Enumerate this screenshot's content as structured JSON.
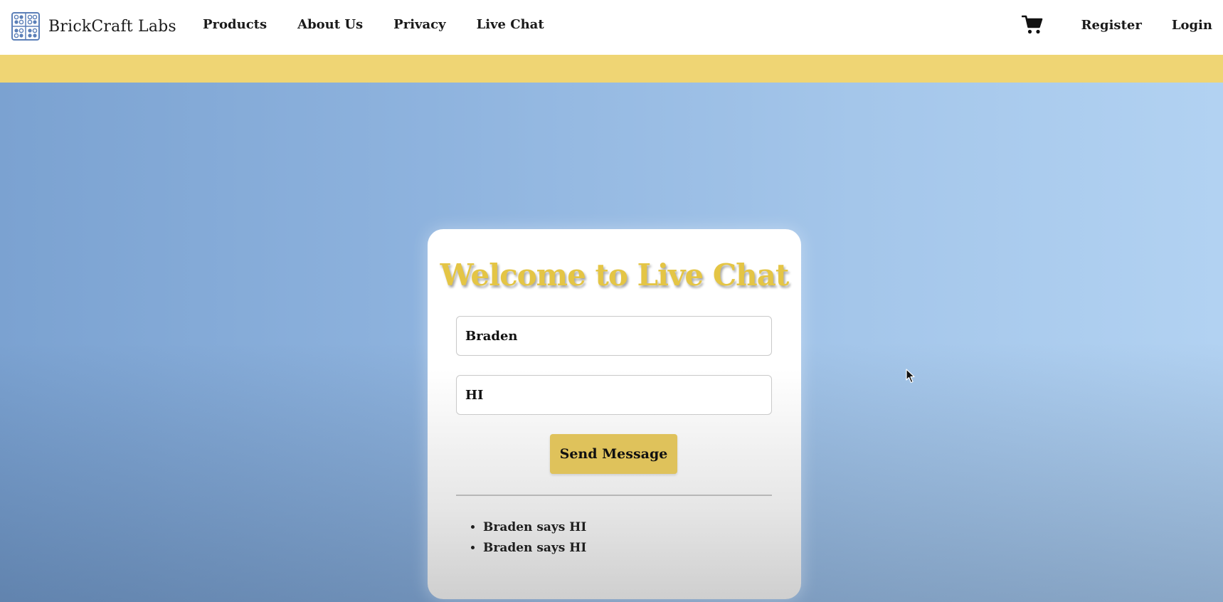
{
  "nav": {
    "brand": "BrickCraft Labs",
    "links": [
      "Products",
      "About Us",
      "Privacy",
      "Live Chat"
    ],
    "register": "Register",
    "login": "Login",
    "cart_icon": "shopping-cart-icon",
    "logo_icon": "grid-logo-icon"
  },
  "colors": {
    "accent_yellow": "#efd574",
    "title_gold": "#e4c545",
    "button_gold": "#dfc25b",
    "hero_blue": "#8eb3de"
  },
  "chat": {
    "title": "Welcome to Live Chat",
    "name_value": "Braden",
    "message_value": "HI",
    "send_label": "Send Message",
    "messages": [
      "Braden says HI",
      "Braden says HI"
    ]
  }
}
